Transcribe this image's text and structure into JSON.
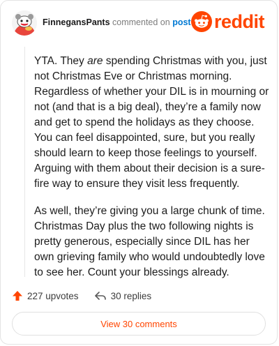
{
  "comment": {
    "author": "FinnegansPants",
    "commented_on": "commented on",
    "post_label": "post",
    "brand": "reddit",
    "paragraphs": [
      {
        "before": "YTA. They ",
        "emphasis": "are",
        "after": " spending Christmas with you, just not Christmas Eve or Christmas morning. Regardless of whether your DIL is in mourning or not (and that is a big deal), they’re a family now and get to spend the holidays as they choose. You can feel disappointed, sure, but you really should learn to keep those feelings to yourself. Arguing with them about their decision is a sure-fire way to ensure they visit less frequently."
      },
      {
        "text": "As well, they’re giving you a large chunk of time. Christmas Day plus the two following nights is pretty generous, especially since DIL has her own grieving family who would undoubtedly love to see her. Count your blessings already."
      }
    ]
  },
  "actions": {
    "upvotes_label": "227 upvotes",
    "replies_label": "30 replies",
    "view_comments_label": "View 30 comments"
  },
  "colors": {
    "brand": "#ff4500",
    "post_link": "#0079d3",
    "upvote": "#ff4500"
  },
  "icons": {
    "avatar": "snoo-avatar",
    "brand": "reddit-logo-icon",
    "upvote": "upvote-arrow-icon",
    "reply": "reply-arrow-icon"
  }
}
